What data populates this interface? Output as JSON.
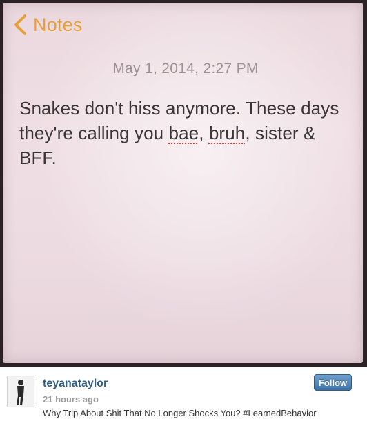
{
  "notes": {
    "back_label": "Notes",
    "back_icon": "chevron-left-icon",
    "date": "May 1, 2014, 2:27 PM",
    "body": {
      "part1": "Snakes don't hiss anymore. These days they're calling you ",
      "word1": "bae",
      "sep1": ", ",
      "word2": "bruh",
      "part2": ", sister & BFF."
    },
    "colors": {
      "accent": "#e7a038",
      "paper": "#ecdbe1",
      "text": "#3a3536",
      "date": "#9d9196",
      "spellcheck": "#d23a3a"
    }
  },
  "post": {
    "username": "teyanataylor",
    "time_ago": "21 hours ago",
    "caption": "Why Trip About Shit That No Longer Shocks You? #LearnedBehavior",
    "follow_label": "Follow",
    "avatar_icon": "profile-photo",
    "colors": {
      "username": "#2f5d85",
      "follow_button": "#3f74a8",
      "time": "#9a9a9a"
    }
  }
}
